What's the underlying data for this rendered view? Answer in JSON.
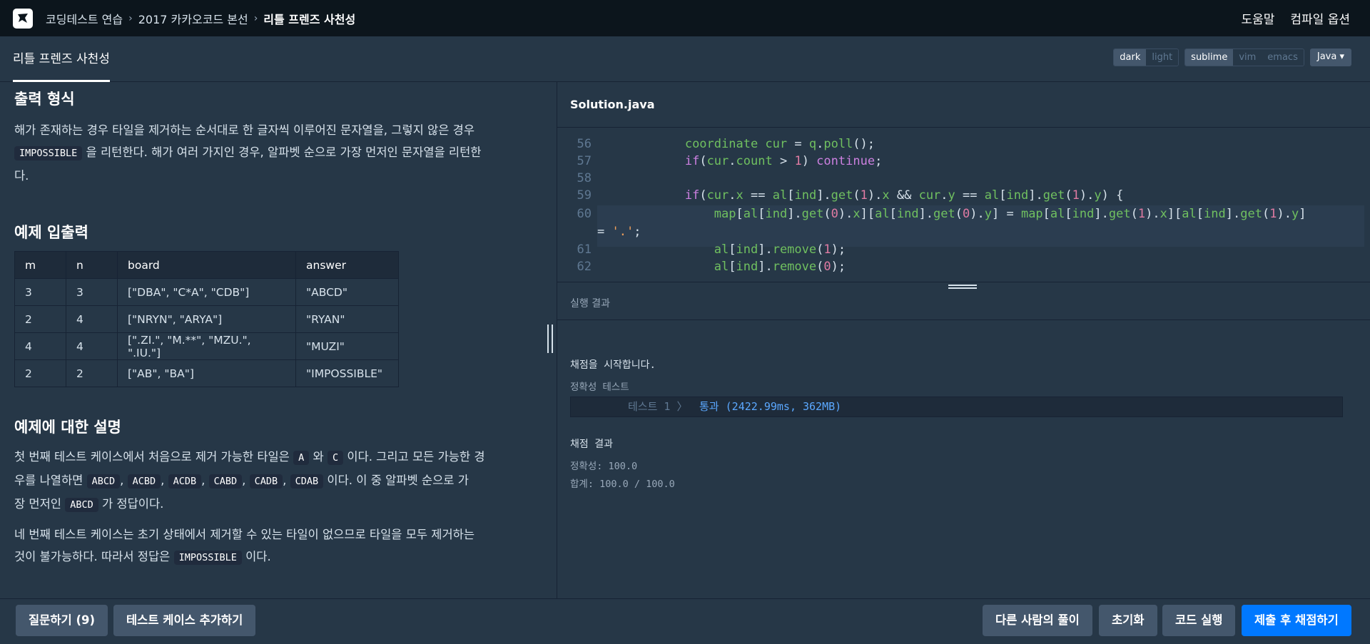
{
  "nav": {
    "breadcrumb": [
      "코딩테스트 연습",
      "2017 카카오코드 본선",
      "리틀 프렌즈 사천성"
    ],
    "help": "도움말",
    "compile_options": "컴파일 옵션"
  },
  "titlebar": {
    "title": "리틀 프렌즈 사천성",
    "theme": [
      "dark",
      "light"
    ],
    "keymap": [
      "sublime",
      "vim",
      "emacs"
    ],
    "language": "Java"
  },
  "problem": {
    "output_heading": "출력 형식",
    "output_p1": "해가 존재하는 경우 타일을 제거하는 순서대로 한 글자씩 이루어진 문자열을, 그렇지 않은 경우",
    "output_code": "IMPOSSIBLE",
    "output_p2": "을 리턴한다. 해가 여러 가지인 경우, 알파벳 순으로 가장 먼저인 문자열을 리턴한",
    "output_p3": "다.",
    "example_heading": "예제 입출력",
    "table_headers": [
      "m",
      "n",
      "board",
      "answer"
    ],
    "table_rows": [
      [
        "3",
        "3",
        "[\"DBA\", \"C*A\", \"CDB\"]",
        "\"ABCD\""
      ],
      [
        "2",
        "4",
        "[\"NRYN\", \"ARYA\"]",
        "\"RYAN\""
      ],
      [
        "4",
        "4",
        "[\".ZI.\", \"M.**\", \"MZU.\", \".IU.\"]",
        "\"MUZI\""
      ],
      [
        "2",
        "2",
        "[\"AB\", \"BA\"]",
        "\"IMPOSSIBLE\""
      ]
    ],
    "explain_heading": "예제에 대한 설명",
    "explain1_a": "첫 번째 테스트 케이스에서 처음으로 제거 가능한 타일은",
    "explain1_codeA": "A",
    "explain1_wa": "와",
    "explain1_codeC": "C",
    "explain1_b": "이다. 그리고 모든 가능한 경",
    "explain1_c": "우를 나열하면",
    "perms": [
      "ABCD",
      "ACBD",
      "ACDB",
      "CABD",
      "CADB",
      "CDAB"
    ],
    "explain1_d": "이다. 이 중 알파벳 순으로 가",
    "explain1_e": "장 먼저인",
    "explain1_code_ans": "ABCD",
    "explain1_f": "가 정답이다.",
    "explain2_a": "네 번째 테스트 케이스는 초기 상태에서 제거할 수 있는 타일이 없으므로 타일을 모두 제거하는",
    "explain2_b": "것이 불가능하다. 따라서 정답은",
    "explain2_code": "IMPOSSIBLE",
    "explain2_c": "이다."
  },
  "editor": {
    "filename": "Solution.java",
    "line_numbers": [
      "56",
      "57",
      "58",
      "59",
      "60",
      "61",
      "62"
    ]
  },
  "result": {
    "heading": "실행 결과",
    "start": "채점을 시작합니다.",
    "section": "정확성  테스트",
    "test_name": "테스트 1 〉",
    "test_result": "통과 (2422.99ms, 362MB)",
    "summary_heading": "채점 결과",
    "accuracy": "정확성: 100.0",
    "total": "합계: 100.0 / 100.0"
  },
  "buttons": {
    "question": "질문하기 (9)",
    "add_testcase": "테스트 케이스 추가하기",
    "others": "다른 사람의 풀이",
    "reset": "초기화",
    "run": "코드 실행",
    "submit": "제출 후 채점하기"
  }
}
